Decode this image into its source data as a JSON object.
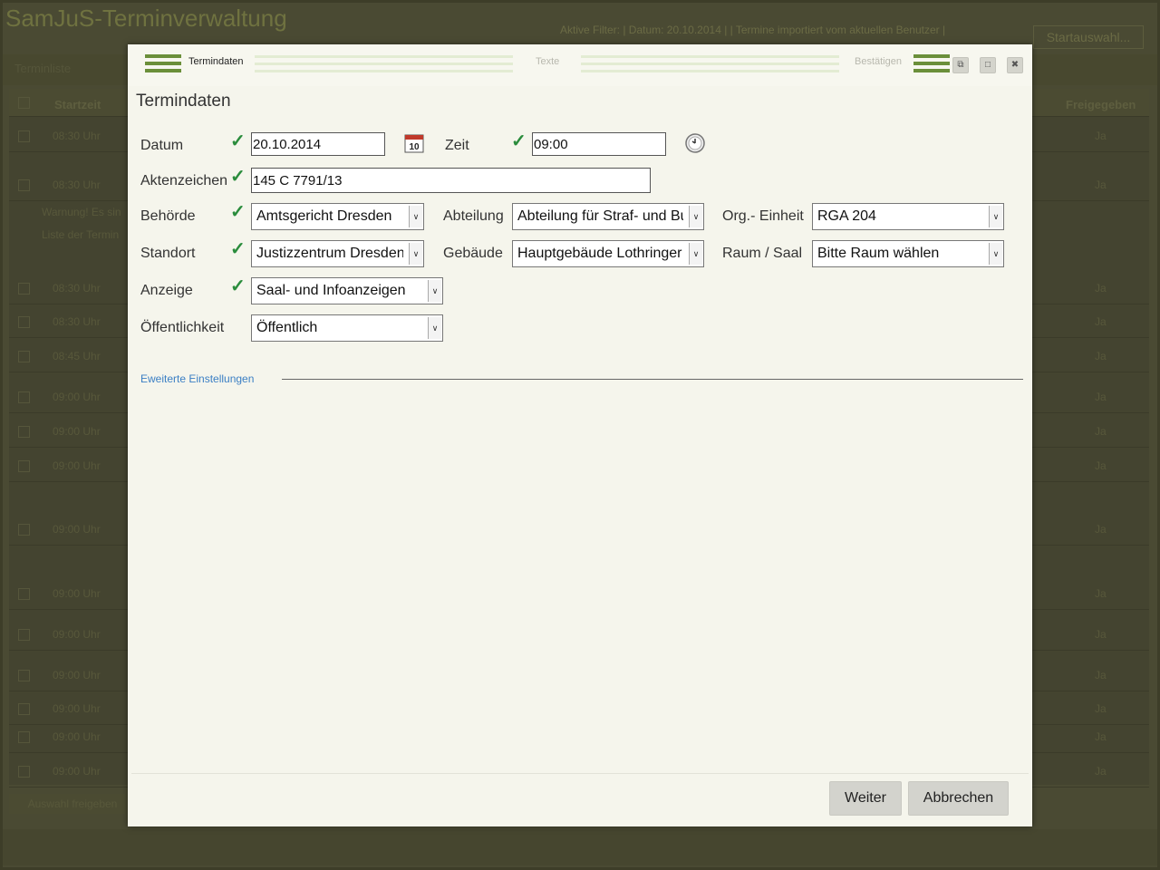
{
  "background": {
    "app_title": "SamJuS-Terminverwaltung",
    "filter_text": "Aktive Filter: | Datum: 20.10.2014 | | Termine importiert vom aktuellen Benutzer |",
    "start_button": "Startauswahl...",
    "tab": "Terminliste",
    "columns": [
      "Startzeit",
      "Freigegeben"
    ],
    "rows": [
      {
        "time": "08:30 Uhr",
        "released": "Ja"
      },
      {
        "time": "08:30 Uhr",
        "released": "Ja"
      },
      {
        "time": "08:30 Uhr",
        "released": "Ja"
      },
      {
        "time": "08:30 Uhr",
        "released": "Ja"
      },
      {
        "time": "08:45 Uhr",
        "released": "Ja"
      },
      {
        "time": "09:00 Uhr",
        "released": "Ja"
      },
      {
        "time": "09:00 Uhr",
        "released": "Ja"
      },
      {
        "time": "09:00 Uhr",
        "released": "Ja"
      },
      {
        "time": "09:00 Uhr",
        "released": "Ja"
      },
      {
        "time": "09:00 Uhr",
        "released": "Ja"
      },
      {
        "time": "09:00 Uhr",
        "released": "Ja"
      },
      {
        "time": "09:00 Uhr",
        "released": "Ja"
      },
      {
        "time": "09:00 Uhr",
        "released": "Ja"
      },
      {
        "time": "09:00 Uhr",
        "released": "Ja"
      },
      {
        "time": "09:00 Uhr",
        "released": "Ja"
      }
    ],
    "warning_line1": "Warnung! Es sin",
    "warning_line2": "Liste der Termin",
    "bottom_button": "Auswahl freigeben"
  },
  "wizard": {
    "steps": [
      "Termindaten",
      "Texte",
      "Bestätigen"
    ]
  },
  "dialog": {
    "heading": "Termindaten",
    "labels": {
      "datum": "Datum",
      "zeit": "Zeit",
      "aktenzeichen": "Aktenzeichen",
      "behoerde": "Behörde",
      "abteilung": "Abteilung",
      "org_einheit": "Org.- Einheit",
      "standort": "Standort",
      "gebaeude": "Gebäude",
      "raum": "Raum / Saal",
      "anzeige": "Anzeige",
      "oeffentlichkeit": "Öffentlichkeit"
    },
    "values": {
      "datum": "20.10.2014",
      "zeit": "09:00",
      "aktenzeichen": "145 C 7791/13",
      "behoerde": "Amtsgericht Dresden",
      "abteilung": "Abteilung für Straf- und Bu",
      "org_einheit": "RGA 204",
      "standort": "Justizzentrum Dresden",
      "gebaeude": "Hauptgebäude Lothringer",
      "raum": "Bitte Raum wählen",
      "anzeige": "Saal- und Infoanzeigen",
      "oeffentlichkeit": "Öffentlich"
    },
    "calendar_day": "10",
    "advanced_link": "Eweiterte Einstellungen",
    "buttons": {
      "next": "Weiter",
      "cancel": "Abbrechen"
    }
  },
  "colors": {
    "accent_green": "#6b8f3a",
    "check_green": "#2a8c3c",
    "link_blue": "#3b7fc4"
  }
}
